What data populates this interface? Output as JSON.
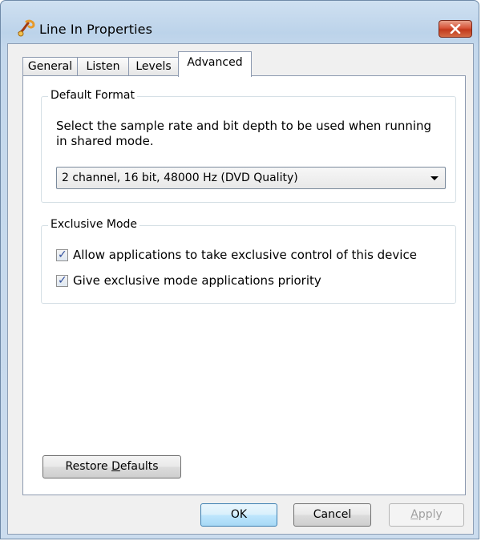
{
  "window": {
    "title": "Line In Properties",
    "close_icon": "close-icon"
  },
  "tabs": [
    {
      "label": "General",
      "active": false
    },
    {
      "label": "Listen",
      "active": false
    },
    {
      "label": "Levels",
      "active": false
    },
    {
      "label": "Advanced",
      "active": true
    }
  ],
  "default_format": {
    "title": "Default Format",
    "description": "Select the sample rate and bit depth to be used when running in shared mode.",
    "selected": "2 channel, 16 bit, 48000 Hz (DVD Quality)"
  },
  "exclusive_mode": {
    "title": "Exclusive Mode",
    "options": [
      {
        "label": "Allow applications to take exclusive control of this device",
        "checked": true
      },
      {
        "label": "Give exclusive mode applications priority",
        "checked": true
      }
    ]
  },
  "restore_defaults": {
    "before": "Restore ",
    "mnemonic": "D",
    "after": "efaults"
  },
  "buttons": {
    "ok": "OK",
    "cancel": "Cancel",
    "apply_mnemonic": "A",
    "apply_rest": "pply"
  }
}
